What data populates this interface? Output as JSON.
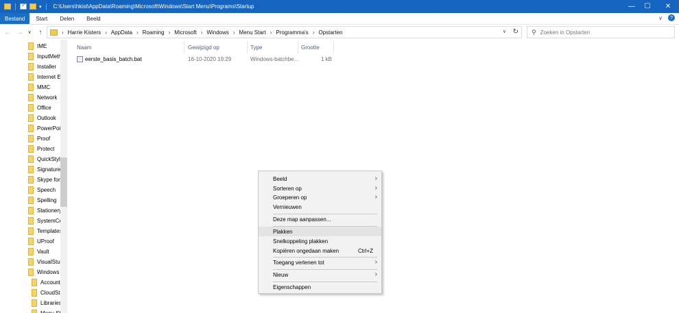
{
  "window": {
    "title_path": "C:\\Users\\hkist\\AppData\\Roaming\\Microsoft\\Windows\\Start Menu\\Programs\\Startup",
    "minimize": "—",
    "maximize": "☐",
    "close": "✕",
    "accent": "#1565c0"
  },
  "ribbon": {
    "tabs": [
      "Bestand",
      "Start",
      "Delen",
      "Beeld"
    ],
    "expand": "∨",
    "help": "?"
  },
  "nav_buttons": {
    "back": "←",
    "forward": "→",
    "recent": "∨",
    "up": "↑"
  },
  "breadcrumb": [
    "Harrie Kisters",
    "AppData",
    "Roaming",
    "Microsoft",
    "Windows",
    "Menu Start",
    "Programma's",
    "Opstarten"
  ],
  "address_extra": {
    "dropdown": "∨",
    "refresh": "↻"
  },
  "search": {
    "placeholder": "Zoeken in Opstarten",
    "icon": "⚲"
  },
  "navpane": {
    "items": [
      "IME",
      "InputMeth",
      "Installer",
      "Internet Ex",
      "MMC",
      "Network",
      "Office",
      "Outlook",
      "PowerPoir",
      "Proof",
      "Protect",
      "QuickStyle",
      "Signatures",
      "Skype for I",
      "Speech",
      "Spelling",
      "Stationery",
      "SystemCer",
      "Templates",
      "UProof",
      "Vault",
      "VisualStud",
      "Windows",
      "Account",
      "CloudSto",
      "Libraries",
      "Menu St"
    ]
  },
  "columns": [
    "Naam",
    "Gewijzigd op",
    "Type",
    "Grootte"
  ],
  "files": [
    {
      "name": "eerste_basis_batch.bat",
      "modified": "16-10-2020 19:29",
      "type": "Windows-batchbe...",
      "size": "1 kB"
    }
  ],
  "context_menu": {
    "items": [
      {
        "label": "Beeld",
        "arrow": "›"
      },
      {
        "label": "Sorteren op",
        "arrow": "›"
      },
      {
        "label": "Groeperen op",
        "arrow": "›"
      },
      {
        "label": "Vernieuwen"
      },
      {
        "label": "Deze map aanpassen..."
      },
      {
        "label": "Plakken"
      },
      {
        "label": "Snelkoppeling plakken"
      },
      {
        "label": "Kopiëren ongedaan maken",
        "shortcut": "Ctrl+Z"
      },
      {
        "label": "Toegang verlenen tot",
        "arrow": "›"
      },
      {
        "label": "Nieuw",
        "arrow": "›"
      },
      {
        "label": "Eigenschappen"
      }
    ]
  }
}
